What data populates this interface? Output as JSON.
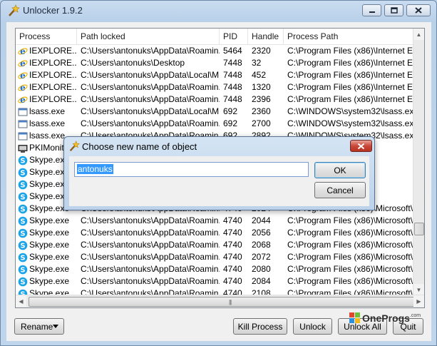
{
  "window": {
    "title": "Unlocker 1.9.2"
  },
  "columns": [
    "Process",
    "Path locked",
    "PID",
    "Handle",
    "Process Path"
  ],
  "rows": [
    {
      "icon": "ie",
      "process": "IEXPLORE....",
      "path": "C:\\Users\\antonuks\\AppData\\Roamin...",
      "pid": "5464",
      "handle": "2320",
      "ppath": "C:\\Program Files (x86)\\Internet Exp"
    },
    {
      "icon": "ie",
      "process": "IEXPLORE....",
      "path": "C:\\Users\\antonuks\\Desktop",
      "pid": "7448",
      "handle": "32",
      "ppath": "C:\\Program Files (x86)\\Internet Exp"
    },
    {
      "icon": "ie",
      "process": "IEXPLORE....",
      "path": "C:\\Users\\antonuks\\AppData\\Local\\M...",
      "pid": "7448",
      "handle": "452",
      "ppath": "C:\\Program Files (x86)\\Internet Exp"
    },
    {
      "icon": "ie",
      "process": "IEXPLORE....",
      "path": "C:\\Users\\antonuks\\AppData\\Roamin...",
      "pid": "7448",
      "handle": "1320",
      "ppath": "C:\\Program Files (x86)\\Internet Exp"
    },
    {
      "icon": "ie",
      "process": "IEXPLORE....",
      "path": "C:\\Users\\antonuks\\AppData\\Roamin...",
      "pid": "7448",
      "handle": "2396",
      "ppath": "C:\\Program Files (x86)\\Internet Exp"
    },
    {
      "icon": "exe",
      "process": "lsass.exe",
      "path": "C:\\Users\\antonuks\\AppData\\Local\\M...",
      "pid": "692",
      "handle": "2360",
      "ppath": "C:\\WINDOWS\\system32\\lsass.exe"
    },
    {
      "icon": "exe",
      "process": "lsass.exe",
      "path": "C:\\Users\\antonuks\\AppData\\Roamin...",
      "pid": "692",
      "handle": "2700",
      "ppath": "C:\\WINDOWS\\system32\\lsass.exe"
    },
    {
      "icon": "exe",
      "process": "lsass.exe",
      "path": "C:\\Users\\antonuks\\AppData\\Roamin...",
      "pid": "692",
      "handle": "2892",
      "ppath": "C:\\WINDOWS\\system32\\lsass.exe"
    },
    {
      "icon": "pki",
      "process": "PKIMonito...",
      "path": "",
      "pid": "",
      "handle": "",
      "ppath": "eToken\\PK"
    },
    {
      "icon": "skype",
      "process": "Skype.exe",
      "path": "",
      "pid": "",
      "handle": "",
      "ppath": "icrosoft\\Sk"
    },
    {
      "icon": "skype",
      "process": "Skype.exe",
      "path": "",
      "pid": "",
      "handle": "",
      "ppath": "icrosoft\\Sk"
    },
    {
      "icon": "skype",
      "process": "Skype.exe",
      "path": "",
      "pid": "",
      "handle": "",
      "ppath": "icrosoft\\Sk"
    },
    {
      "icon": "skype",
      "process": "Skype.exe",
      "path": "",
      "pid": "",
      "handle": "",
      "ppath": "icrosoft\\Sk"
    },
    {
      "icon": "skype",
      "process": "Skype.exe",
      "path": "C:\\Users\\antonuks\\AppData\\Roamin...",
      "pid": "4740",
      "handle": "2024",
      "ppath": "C:\\Program Files (x86)\\Microsoft\\Sk"
    },
    {
      "icon": "skype",
      "process": "Skype.exe",
      "path": "C:\\Users\\antonuks\\AppData\\Roamin...",
      "pid": "4740",
      "handle": "2044",
      "ppath": "C:\\Program Files (x86)\\Microsoft\\Sk"
    },
    {
      "icon": "skype",
      "process": "Skype.exe",
      "path": "C:\\Users\\antonuks\\AppData\\Roamin...",
      "pid": "4740",
      "handle": "2056",
      "ppath": "C:\\Program Files (x86)\\Microsoft\\Sk"
    },
    {
      "icon": "skype",
      "process": "Skype.exe",
      "path": "C:\\Users\\antonuks\\AppData\\Roamin...",
      "pid": "4740",
      "handle": "2068",
      "ppath": "C:\\Program Files (x86)\\Microsoft\\Sk"
    },
    {
      "icon": "skype",
      "process": "Skype.exe",
      "path": "C:\\Users\\antonuks\\AppData\\Roamin...",
      "pid": "4740",
      "handle": "2072",
      "ppath": "C:\\Program Files (x86)\\Microsoft\\Sk"
    },
    {
      "icon": "skype",
      "process": "Skype.exe",
      "path": "C:\\Users\\antonuks\\AppData\\Roamin...",
      "pid": "4740",
      "handle": "2080",
      "ppath": "C:\\Program Files (x86)\\Microsoft\\Sk"
    },
    {
      "icon": "skype",
      "process": "Skype.exe",
      "path": "C:\\Users\\antonuks\\AppData\\Roamin...",
      "pid": "4740",
      "handle": "2084",
      "ppath": "C:\\Program Files (x86)\\Microsoft\\Sk"
    },
    {
      "icon": "skype",
      "process": "Skype.exe",
      "path": "C:\\Users\\antonuks\\AppData\\Roamin...",
      "pid": "4740",
      "handle": "2108",
      "ppath": "C:\\Program Files (x86)\\Microsoft\\Sk"
    }
  ],
  "action_dropdown": {
    "selected": "Rename"
  },
  "buttons": {
    "kill_process": "Kill Process",
    "unlock": "Unlock",
    "unlock_all": "Unlock All",
    "quit": "Quit"
  },
  "dialog": {
    "title": "Choose new name of object",
    "input_value": "antonuks",
    "ok": "OK",
    "cancel": "Cancel"
  },
  "watermark": {
    "text": "OneProgs",
    "suffix": ".com"
  },
  "colors": {
    "selection": "#3399ff",
    "title_bar": "#bcd3ea",
    "close_button": "#c9483a"
  }
}
